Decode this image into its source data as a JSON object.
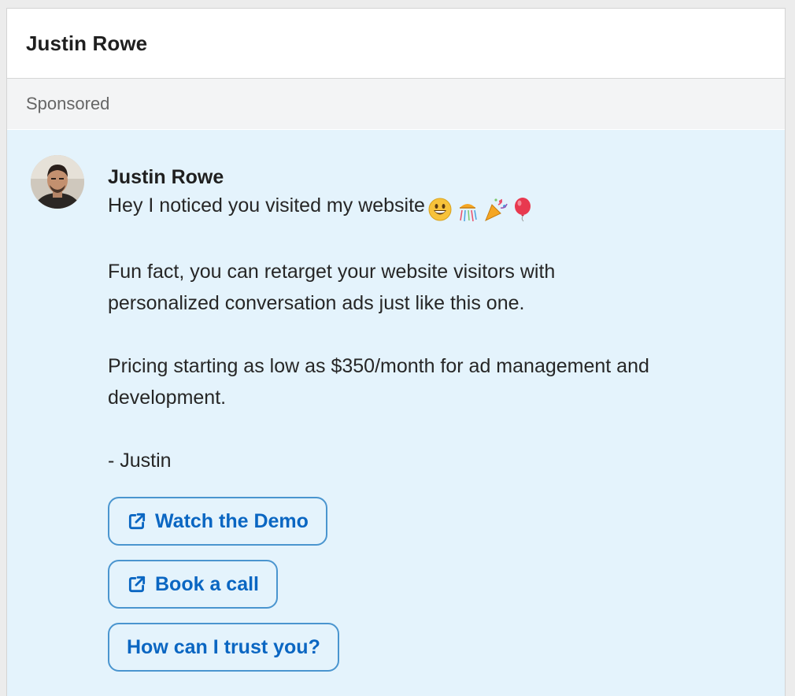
{
  "header": {
    "title": "Justin Rowe"
  },
  "sponsored": {
    "label": "Sponsored"
  },
  "message": {
    "sender": "Justin Rowe",
    "line1": "Hey I noticed you visited my website",
    "emojis": [
      "grinning-face",
      "confetti-ball",
      "party-popper",
      "balloon"
    ],
    "para2_line1": "Fun fact, you can retarget your website visitors with",
    "para2_line2": "personalized conversation ads just like this one.",
    "para3_line1": "Pricing starting as low as $350/month for ad management and",
    "para3_line2": "development.",
    "signature": "- Justin"
  },
  "ctas": [
    {
      "label": "Watch the Demo",
      "icon": "external-link-icon"
    },
    {
      "label": "Book a call",
      "icon": "external-link-icon"
    },
    {
      "label": "How can I trust you?",
      "icon": ""
    }
  ],
  "colors": {
    "accent": "#0a66c2",
    "button_border": "#4a95cf",
    "message_bg": "#e4f3fc",
    "sponsored_bg": "#f3f4f5"
  }
}
